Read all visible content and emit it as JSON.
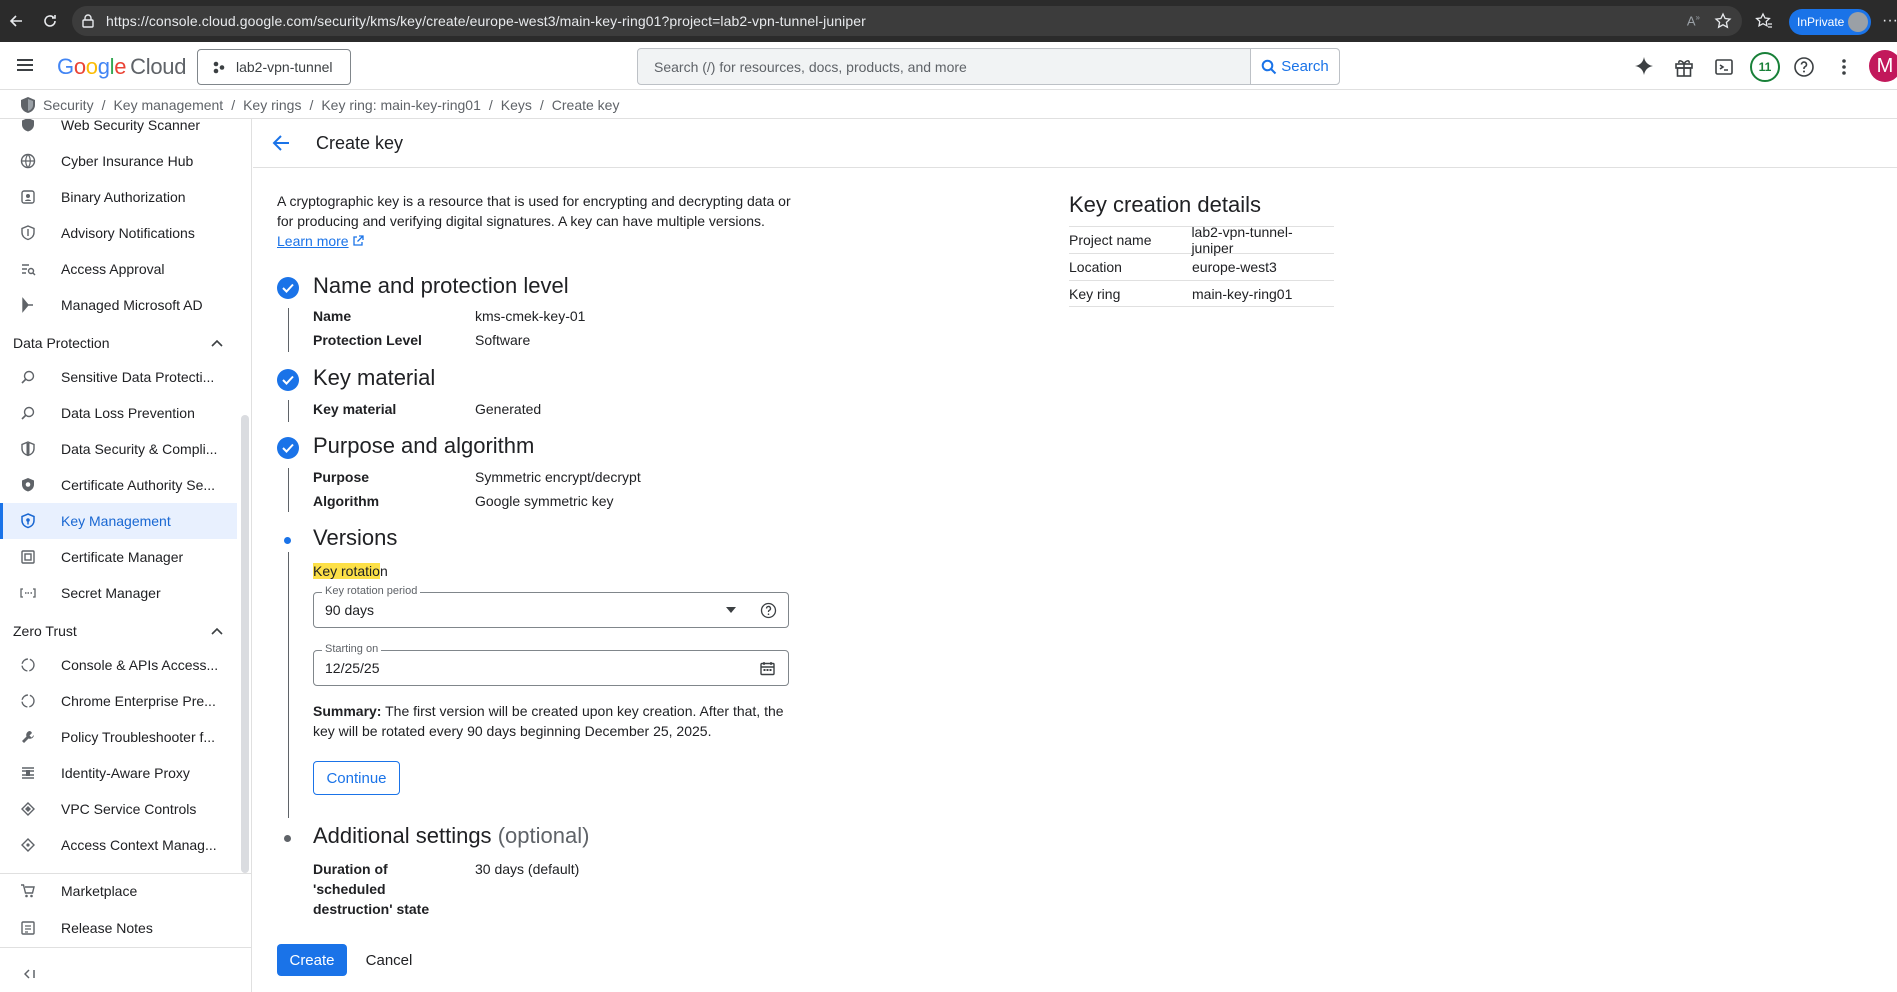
{
  "browser": {
    "url": "https://console.cloud.google.com/security/kms/key/create/europe-west3/main-key-ring01?project=lab2-vpn-tunnel-juniper",
    "inprivate_label": "InPrivate"
  },
  "header": {
    "logo_google": "Google",
    "logo_cloud": "Cloud",
    "project": "lab2-vpn-tunnel",
    "search_placeholder": "Search (/) for resources, docs, products, and more",
    "search_button": "Search",
    "notifications_count": "11",
    "avatar_initial": "M"
  },
  "breadcrumb": {
    "items": [
      "Security",
      "Key management",
      "Key rings",
      "Key ring: main-key-ring01",
      "Keys",
      "Create key"
    ]
  },
  "sidebar": {
    "items_top": [
      {
        "label": "Web Security Scanner",
        "icon": "shield-icon"
      },
      {
        "label": "Cyber Insurance Hub",
        "icon": "globe-icon"
      },
      {
        "label": "Binary Authorization",
        "icon": "binary-icon"
      },
      {
        "label": "Advisory Notifications",
        "icon": "shield-icon"
      },
      {
        "label": "Access Approval",
        "icon": "access-icon"
      },
      {
        "label": "Managed Microsoft AD",
        "icon": "ad-icon"
      }
    ],
    "section_data_protection": "Data Protection",
    "items_data_protection": [
      {
        "label": "Sensitive Data Protecti...",
        "icon": "search-data-icon"
      },
      {
        "label": "Data Loss Prevention",
        "icon": "search-data-icon"
      },
      {
        "label": "Data Security & Compli...",
        "icon": "shield-icon"
      },
      {
        "label": "Certificate Authority Se...",
        "icon": "shield-icon"
      },
      {
        "label": "Key Management",
        "icon": "shield-key-icon"
      },
      {
        "label": "Certificate Manager",
        "icon": "certificate-icon"
      },
      {
        "label": "Secret Manager",
        "icon": "secret-icon"
      }
    ],
    "section_zero_trust": "Zero Trust",
    "items_zero_trust": [
      {
        "label": "Console & APIs Access...",
        "icon": "circle-icon"
      },
      {
        "label": "Chrome Enterprise Pre...",
        "icon": "circle-icon"
      },
      {
        "label": "Policy Troubleshooter f...",
        "icon": "wrench-icon"
      },
      {
        "label": "Identity-Aware Proxy",
        "icon": "proxy-icon"
      },
      {
        "label": "VPC Service Controls",
        "icon": "vpc-icon"
      },
      {
        "label": "Access Context Manag...",
        "icon": "context-icon"
      }
    ],
    "items_bottom": [
      {
        "label": "Marketplace",
        "icon": "cart-icon"
      },
      {
        "label": "Release Notes",
        "icon": "notes-icon"
      }
    ]
  },
  "main": {
    "title": "Create key",
    "intro": "A cryptographic key is a resource that is used for encrypting and decrypting data or for producing and verifying digital signatures. A key can have multiple versions.",
    "learn_more": "Learn more",
    "steps": {
      "name_title": "Name and protection level",
      "name_label": "Name",
      "name_value": "kms-cmek-key-01",
      "protection_label": "Protection Level",
      "protection_value": "Software",
      "material_title": "Key material",
      "material_label": "Key material",
      "material_value": "Generated",
      "purpose_title": "Purpose and algorithm",
      "purpose_label": "Purpose",
      "purpose_value": "Symmetric encrypt/decrypt",
      "algorithm_label": "Algorithm",
      "algorithm_value": "Google symmetric key",
      "versions_title": "Versions",
      "key_rotation_highlight": "Key rotatio",
      "key_rotation_rest": "n",
      "rotation_period_label": "Key rotation period",
      "rotation_period_value": "90 days",
      "starting_on_label": "Starting on",
      "starting_on_value": "12/25/25",
      "summary_bold": "Summary:",
      "summary_text": " The first version will be created upon key creation. After that, the key will be rotated every 90 days beginning December 25, 2025.",
      "continue": "Continue",
      "additional_title": "Additional settings",
      "additional_optional": "(optional)",
      "destruction_label": "Duration of 'scheduled destruction' state",
      "destruction_value": "30 days (default)"
    },
    "create": "Create",
    "cancel": "Cancel"
  },
  "details": {
    "title": "Key creation details",
    "rows": [
      {
        "key": "Project name",
        "value": "lab2-vpn-tunnel-juniper"
      },
      {
        "key": "Location",
        "value": "europe-west3"
      },
      {
        "key": "Key ring",
        "value": "main-key-ring01"
      }
    ]
  }
}
